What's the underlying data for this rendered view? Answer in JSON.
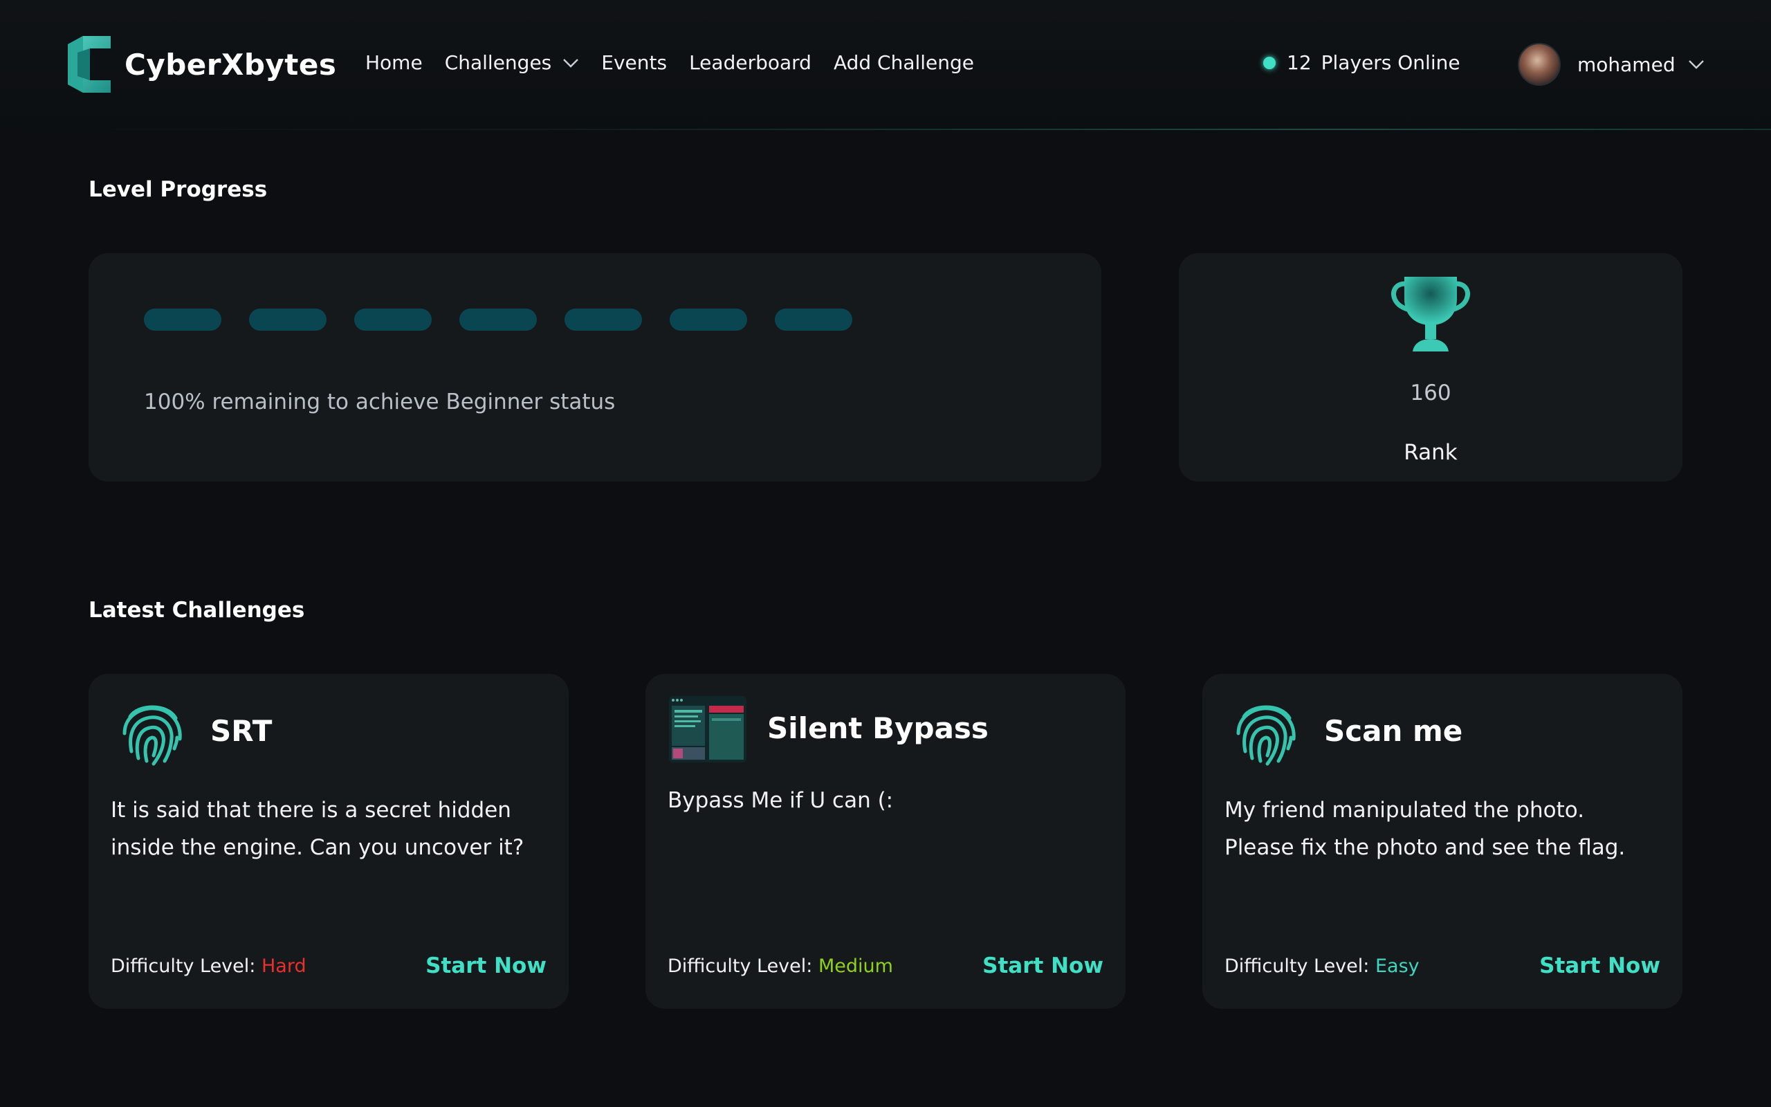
{
  "header": {
    "brand": "CyberXbytes",
    "nav": [
      "Home",
      "Challenges",
      "Events",
      "Leaderboard",
      "Add Challenge"
    ],
    "players_online_count": "12",
    "players_online_label": "Players Online",
    "username": "mohamed"
  },
  "level_progress": {
    "title": "Level Progress",
    "segments_total": 7,
    "segments_filled": 0,
    "progress_fraction": 0,
    "status_text": "100% remaining to achieve Beginner status",
    "rank_value": "160",
    "rank_label": "Rank"
  },
  "latest_challenges": {
    "title": "Latest Challenges",
    "items": [
      {
        "title": "SRT",
        "icon": "fingerprint-icon",
        "description": "It is said that there is a secret hidden inside the engine. Can you uncover it?",
        "difficulty_label": "Difficulty Level:",
        "difficulty": "Hard",
        "difficulty_color": "#e8302e",
        "action": "Start Now"
      },
      {
        "title": "Silent Bypass",
        "icon": "screen-thumbnail-icon",
        "description": "Bypass Me if U can (:",
        "difficulty_label": "Difficulty Level:",
        "difficulty": "Medium",
        "difficulty_color": "#8fd11b",
        "action": "Start Now"
      },
      {
        "title": "Scan me",
        "icon": "fingerprint-icon",
        "description": "My friend manipulated the photo. Please fix the photo and see the flag.",
        "difficulty_label": "Difficulty Level:",
        "difficulty": "Easy",
        "difficulty_color": "#3fd6c1",
        "action": "Start Now"
      }
    ]
  },
  "colors": {
    "accent": "#3fe0c5",
    "background": "#0c0e11",
    "card": "#16191c",
    "progress_empty": "#0a4652"
  }
}
